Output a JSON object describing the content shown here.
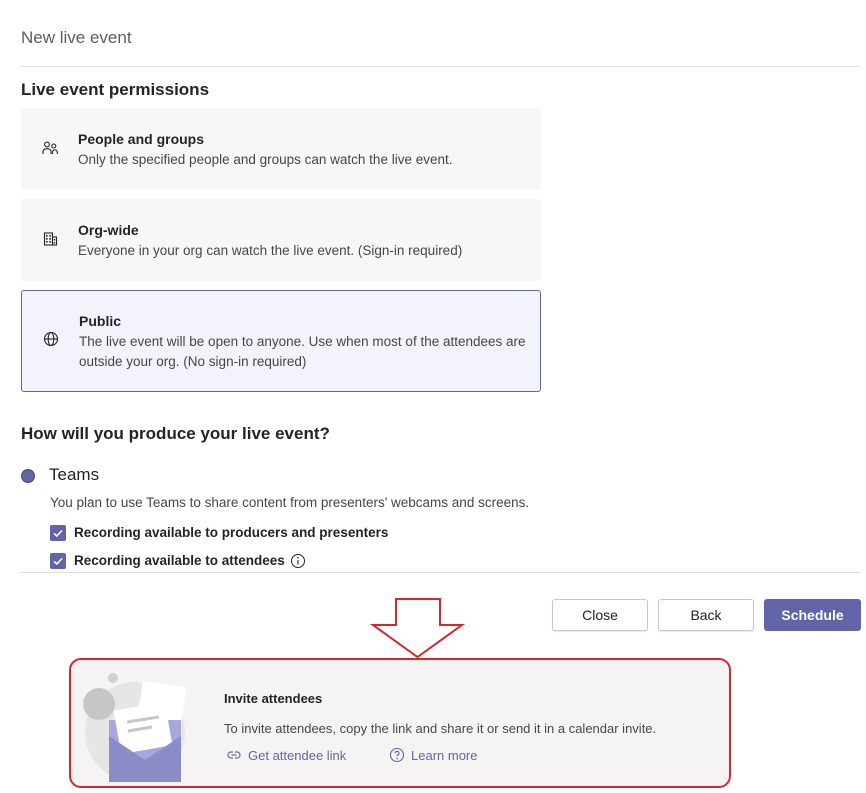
{
  "page": {
    "title": "New live event"
  },
  "permissions": {
    "heading": "Live event permissions",
    "options": [
      {
        "icon": "people-icon",
        "title": "People and groups",
        "desc": "Only the specified people and groups can watch the live event.",
        "selected": false
      },
      {
        "icon": "building-icon",
        "title": "Org-wide",
        "desc": "Everyone in your org can watch the live event. (Sign-in required)",
        "selected": false
      },
      {
        "icon": "globe-icon",
        "title": "Public",
        "desc": "The live event will be open to anyone. Use when most of the attendees are outside your org. (No sign-in required)",
        "selected": true
      }
    ]
  },
  "produce": {
    "heading": "How will you produce your live event?",
    "option_label": "Teams",
    "option_desc": "You plan to use Teams to share content from presenters' webcams and screens.",
    "checkboxes": [
      {
        "label": "Recording available to producers and presenters",
        "checked": true
      },
      {
        "label": "Recording available to attendees",
        "checked": true
      }
    ]
  },
  "actions": {
    "close_label": "Close",
    "back_label": "Back",
    "schedule_label": "Schedule"
  },
  "invite": {
    "title": "Invite attendees",
    "desc": "To invite attendees, copy the link and share it or send it in a calendar invite.",
    "link_label": "Get attendee link",
    "learn_label": "Learn more"
  },
  "colors": {
    "accent": "#6264a7",
    "highlight": "#d9262d"
  }
}
